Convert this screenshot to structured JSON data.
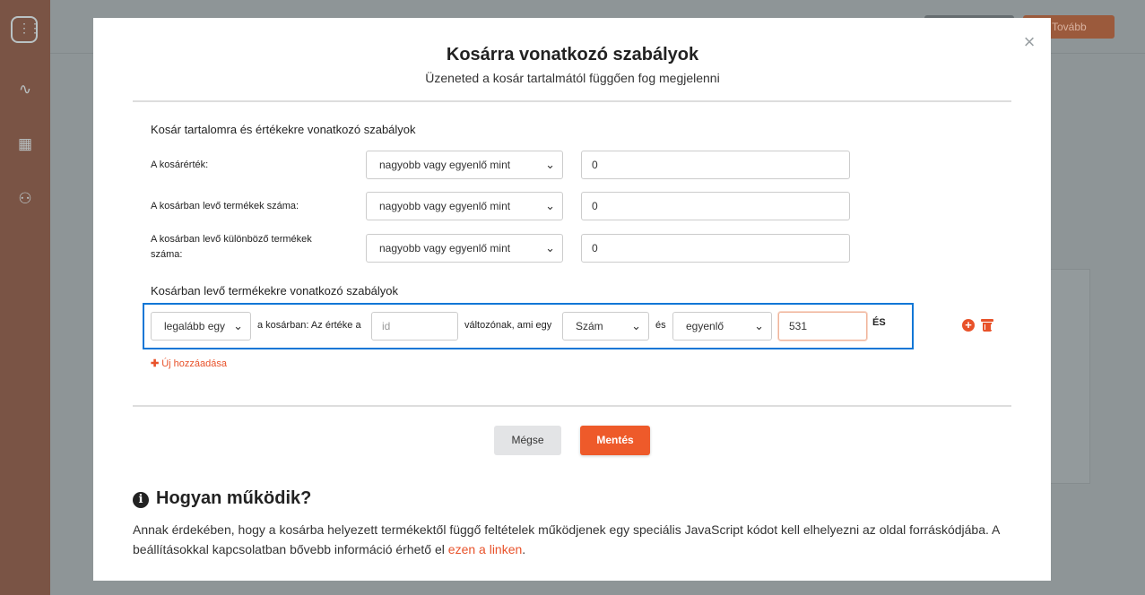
{
  "background": {
    "next_button_label": "Tovább"
  },
  "modal": {
    "title": "Kosárra vonatkozó szabályok",
    "subtitle": "Üzeneted a kosár tartalmától függően fog megjelenni",
    "close_icon": "close-icon"
  },
  "cart_rules": {
    "section_title": "Kosár tartalomra és értékekre vonatkozó szabályok",
    "rows": [
      {
        "label": "A kosárérték:",
        "operator": "nagyobb vagy egyenlő mint",
        "value": "0"
      },
      {
        "label": "A kosárban levő termékek száma:",
        "operator": "nagyobb vagy egyenlő mint",
        "value": "0"
      },
      {
        "label": "A kosárban levő különböző termékek száma:",
        "operator": "nagyobb vagy egyenlő mint",
        "value": "0"
      }
    ]
  },
  "product_rules": {
    "section_title": "Kosárban levő termékekre vonatkozó szabályok",
    "rule": {
      "quantifier": "legalább egy",
      "text_in_cart": "a kosárban: Az értéke a",
      "variable_placeholder": "id",
      "text_variable": "változónak, ami egy",
      "type": "Szám",
      "text_and": "és",
      "comparator": "egyenlő",
      "value": "531",
      "conjunction": "ÉS"
    },
    "add_new_label": "Új hozzáadása"
  },
  "buttons": {
    "cancel": "Mégse",
    "save": "Mentés"
  },
  "how_it_works": {
    "title": "Hogyan működik?",
    "text": "Annak érdekében, hogy a kosárba helyezett termékektől függő feltételek működjenek egy speciális JavaScript kódot kell elhelyezni az oldal forráskódjába. A beállításokkal kapcsolatban bővebb információ érhető el ",
    "link_text": "ezen a linken",
    "text_end": "."
  },
  "colors": {
    "accent": "#ee5a2a",
    "highlight_border": "#1277d6"
  }
}
